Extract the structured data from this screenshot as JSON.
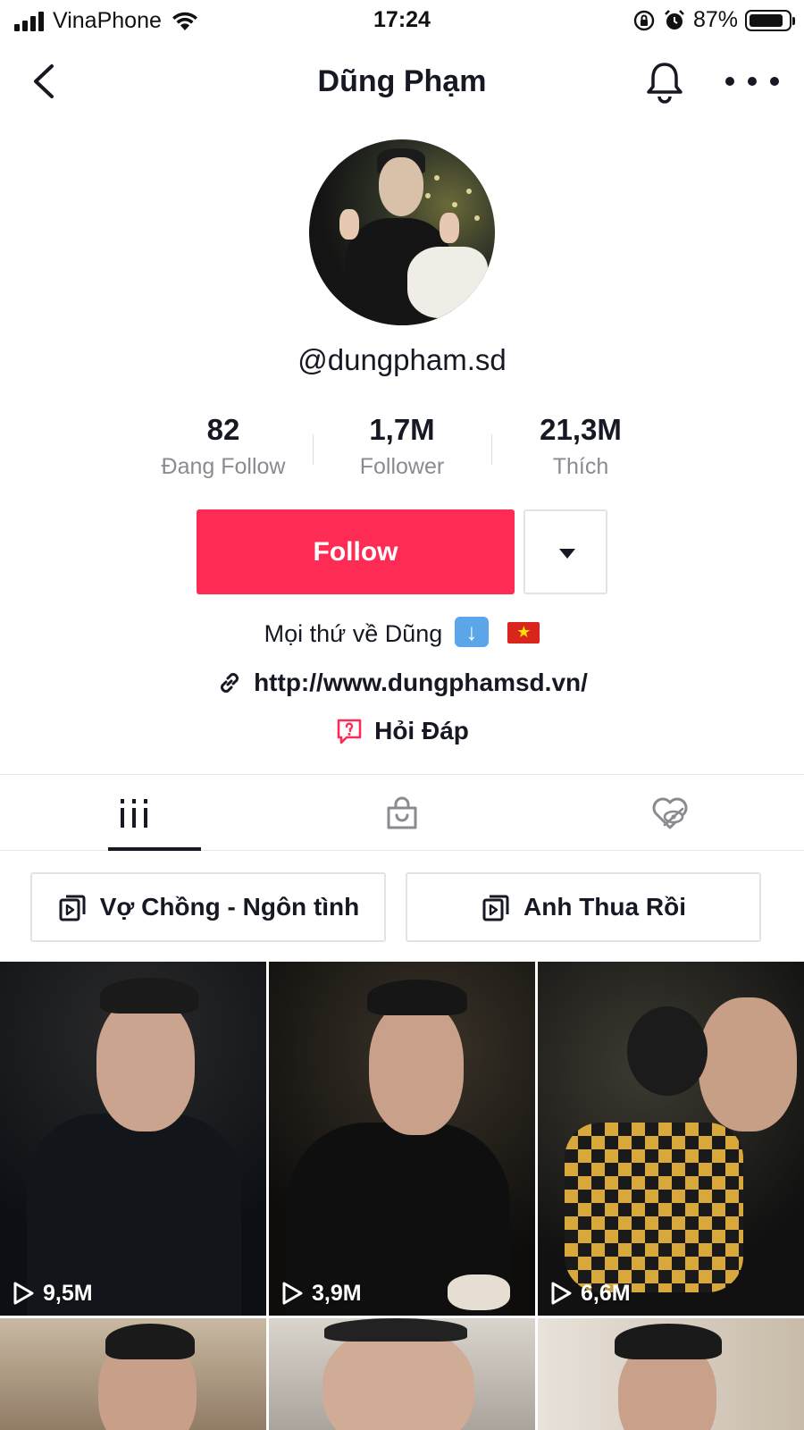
{
  "status_bar": {
    "carrier": "VinaPhone",
    "time": "17:24",
    "battery_pct": "87%"
  },
  "header": {
    "title": "Dũng Phạm"
  },
  "profile": {
    "username": "@dungpham.sd",
    "stats": [
      {
        "value": "82",
        "label": "Đang Follow"
      },
      {
        "value": "1,7M",
        "label": "Follower"
      },
      {
        "value": "21,3M",
        "label": "Thích"
      }
    ],
    "follow_label": "Follow",
    "bio": "Mọi thứ về Dũng",
    "link": "http://www.dungphamsd.vn/",
    "qa_label": "Hỏi Đáp"
  },
  "tabs": [
    {
      "icon": "grid-icon",
      "active": true
    },
    {
      "icon": "shopping-bag-icon",
      "active": false
    },
    {
      "icon": "liked-hidden-icon",
      "active": false
    }
  ],
  "playlists": [
    {
      "label": "Vợ Chồng - Ngôn tình"
    },
    {
      "label": "Anh Thua Rồi"
    }
  ],
  "videos": [
    {
      "views": "9,5M"
    },
    {
      "views": "3,9M"
    },
    {
      "views": "6,6M"
    },
    {
      "views": ""
    },
    {
      "views": ""
    },
    {
      "views": ""
    }
  ],
  "colors": {
    "accent": "#fe2c55",
    "text": "#161823",
    "muted": "#8a8b91"
  }
}
